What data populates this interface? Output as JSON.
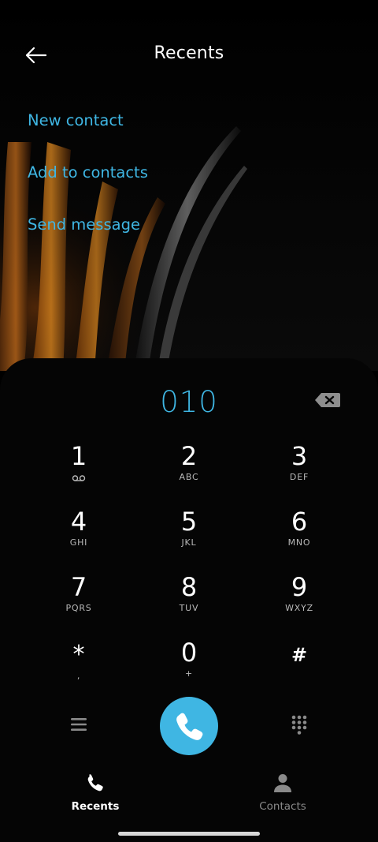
{
  "header": {
    "title": "Recents",
    "back_icon": "arrow-left-icon"
  },
  "actions": {
    "new_contact": "New contact",
    "add_to_contacts": "Add to contacts",
    "send_message": "Send message"
  },
  "dialer": {
    "number": "010",
    "backspace_icon": "backspace-icon",
    "keys": [
      {
        "digit": "1",
        "letters": "voicemail-icon"
      },
      {
        "digit": "2",
        "letters": "ABC"
      },
      {
        "digit": "3",
        "letters": "DEF"
      },
      {
        "digit": "4",
        "letters": "GHI"
      },
      {
        "digit": "5",
        "letters": "JKL"
      },
      {
        "digit": "6",
        "letters": "MNO"
      },
      {
        "digit": "7",
        "letters": "PQRS"
      },
      {
        "digit": "8",
        "letters": "TUV"
      },
      {
        "digit": "9",
        "letters": "WXYZ"
      },
      {
        "digit": "*",
        "letters": ","
      },
      {
        "digit": "0",
        "letters": "+"
      },
      {
        "digit": "#",
        "letters": ""
      }
    ]
  },
  "bottom_nav": {
    "recents": "Recents",
    "contacts": "Contacts"
  },
  "colors": {
    "accent": "#3fb6e3",
    "background": "#000000",
    "tab_active": "#ffffff",
    "tab_inactive": "#8a8a8a"
  }
}
